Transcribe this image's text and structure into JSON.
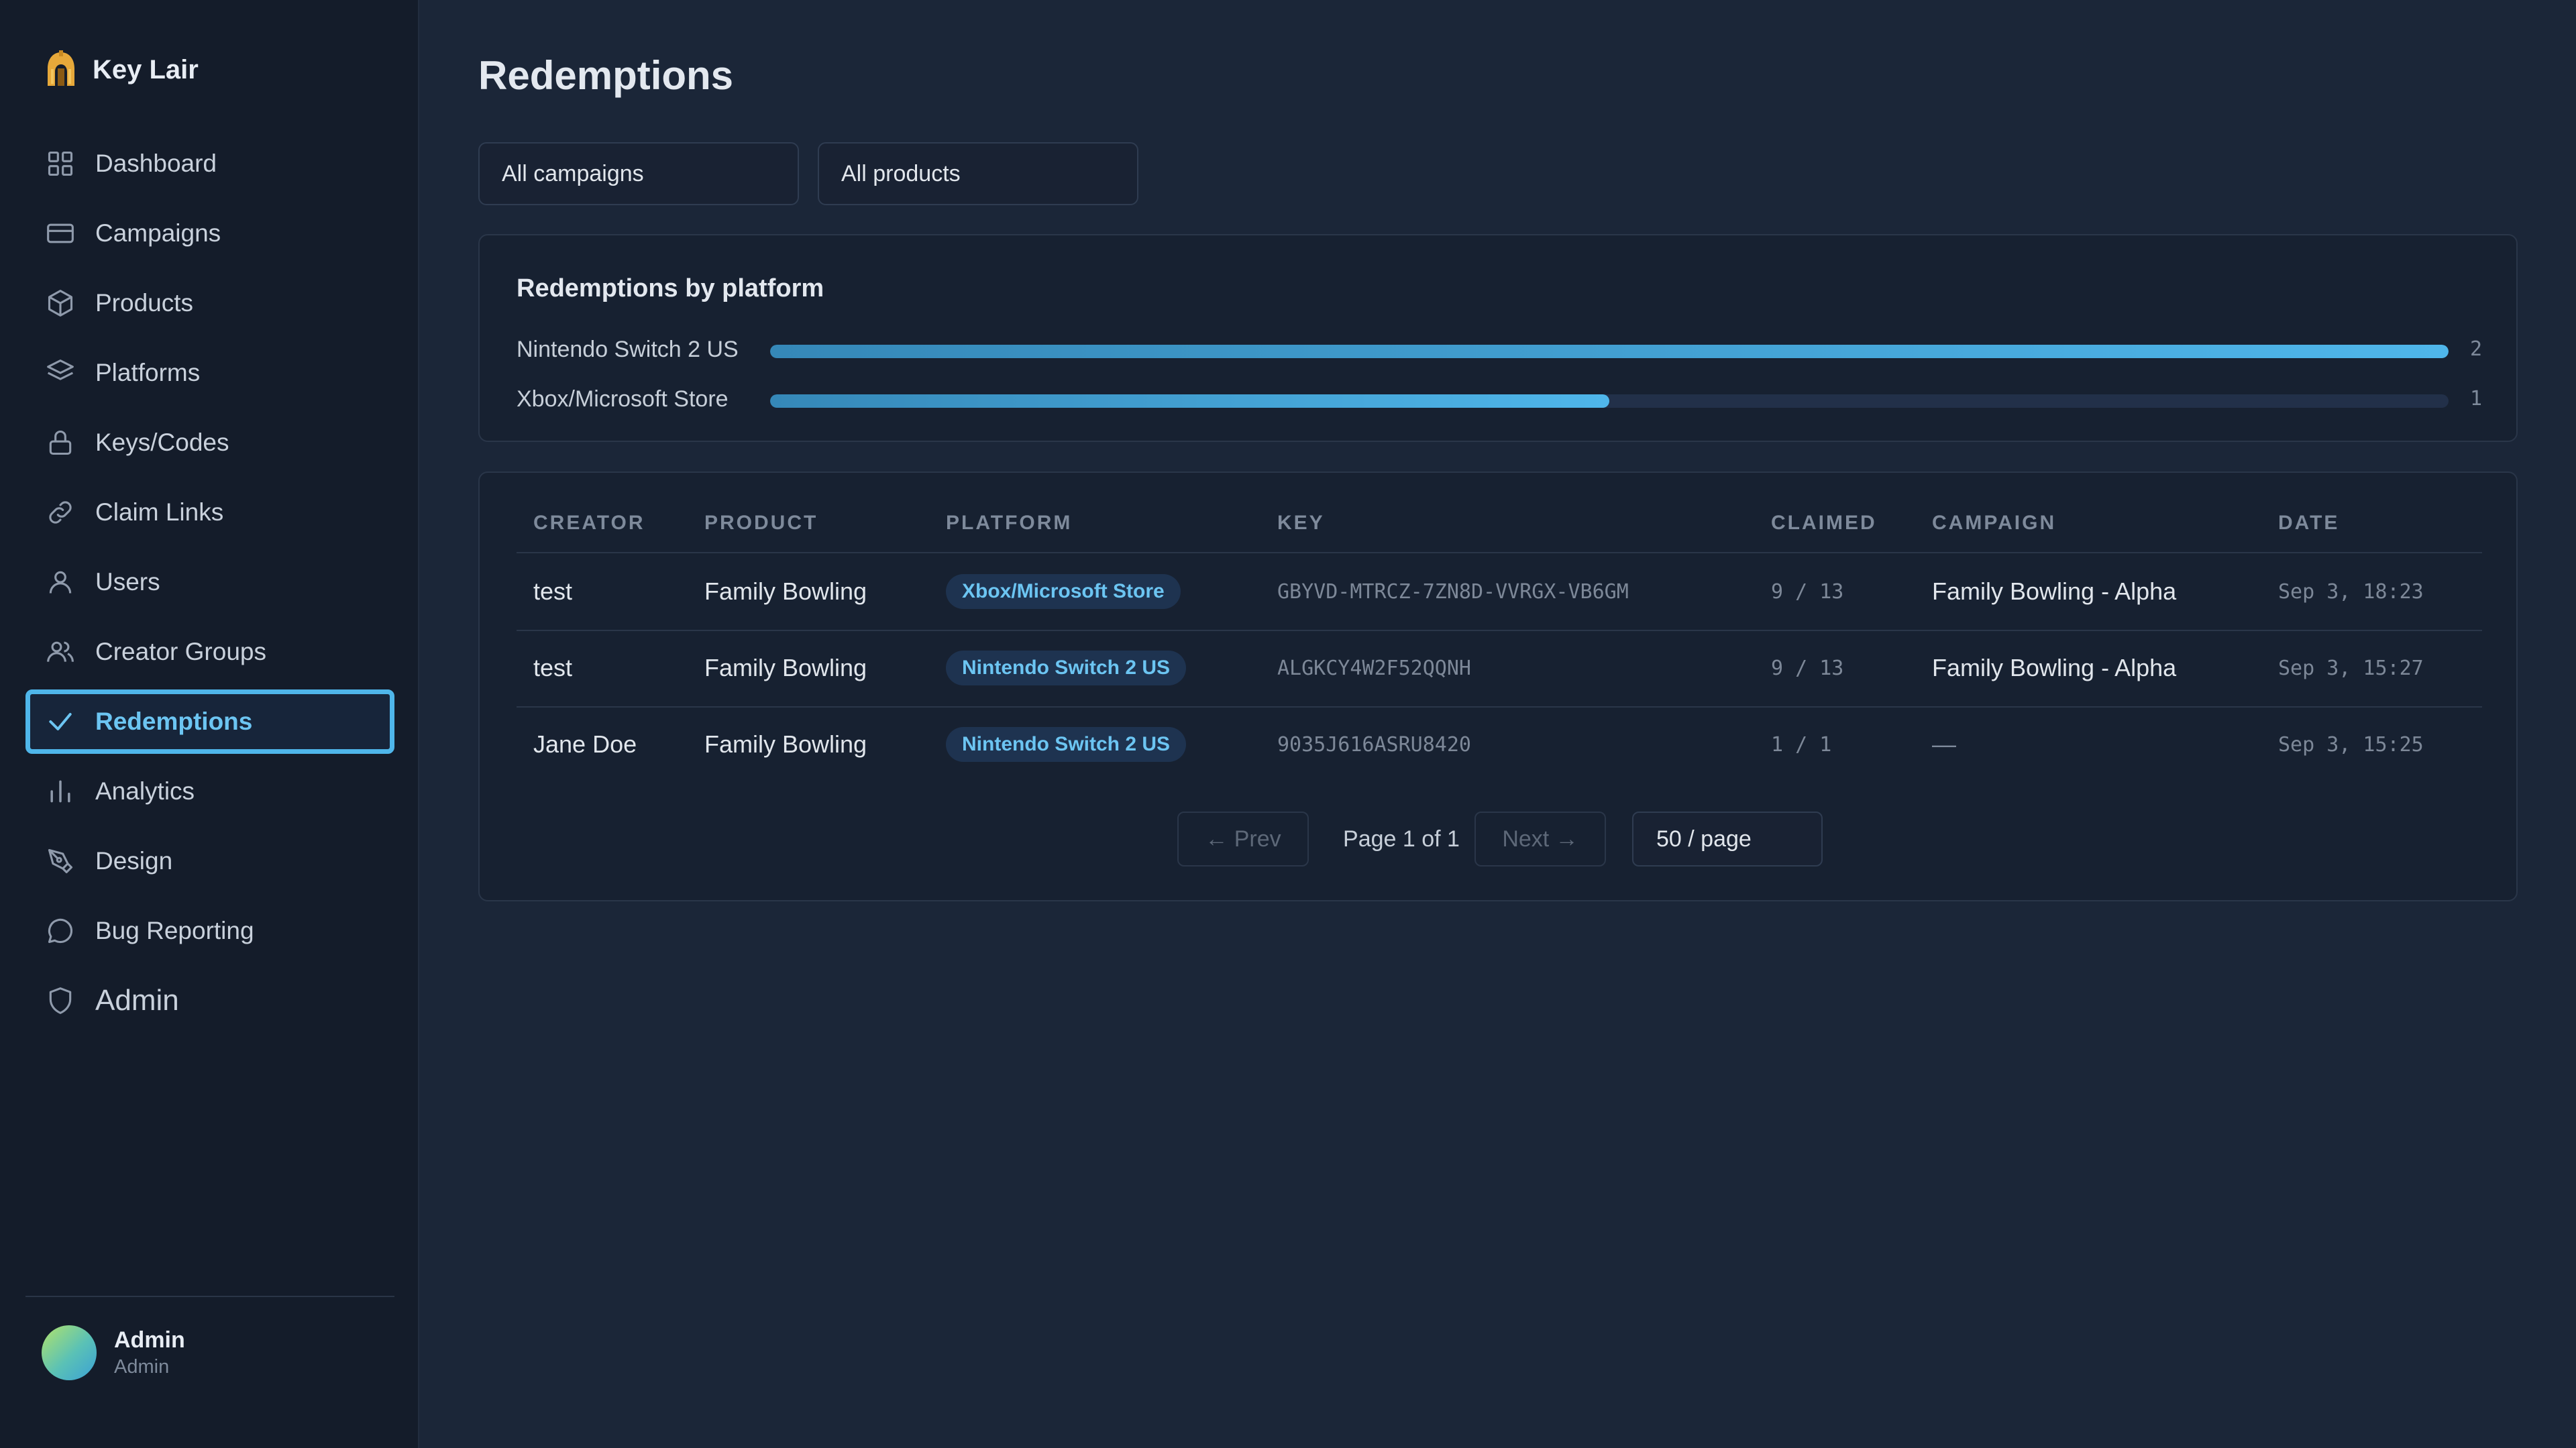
{
  "brand": {
    "name": "Key Lair",
    "icon": "gold-helmet-icon",
    "accent": "#e6a83a"
  },
  "sidebar": {
    "items": [
      {
        "label": "Dashboard",
        "icon": "grid-icon"
      },
      {
        "label": "Campaigns",
        "icon": "card-icon"
      },
      {
        "label": "Products",
        "icon": "cube-icon"
      },
      {
        "label": "Platforms",
        "icon": "layers-icon"
      },
      {
        "label": "Keys/Codes",
        "icon": "lock-icon"
      },
      {
        "label": "Claim Links",
        "icon": "link-icon"
      },
      {
        "label": "Users",
        "icon": "user-icon"
      },
      {
        "label": "Creator Groups",
        "icon": "users-icon"
      },
      {
        "label": "Redemptions",
        "icon": "check-icon",
        "active": true
      },
      {
        "label": "Analytics",
        "icon": "bar-chart-icon"
      },
      {
        "label": "Design",
        "icon": "pen-tool-icon"
      },
      {
        "label": "Bug Reporting",
        "icon": "message-circle-icon"
      },
      {
        "label": "Admin",
        "icon": "shield-icon"
      }
    ]
  },
  "user": {
    "name": "Admin",
    "role": "Admin"
  },
  "page": {
    "title": "Redemptions"
  },
  "filters": {
    "campaign": "All campaigns",
    "product": "All products"
  },
  "chart_data": {
    "type": "bar",
    "title": "Redemptions by platform",
    "orientation": "horizontal",
    "categories": [
      "Nintendo Switch 2 US",
      "Xbox/Microsoft Store"
    ],
    "values": [
      2,
      1
    ],
    "xlim": [
      0,
      2
    ],
    "bar_color": "#4fb6ea"
  },
  "table": {
    "columns": [
      "CREATOR",
      "PRODUCT",
      "PLATFORM",
      "KEY",
      "CLAIMED",
      "CAMPAIGN",
      "DATE"
    ],
    "rows": [
      {
        "creator": "test",
        "product": "Family Bowling",
        "platform": "Xbox/Microsoft Store",
        "key": "GBYVD-MTRCZ-7ZN8D-VVRGX-VB6GM",
        "claimed": "9 / 13",
        "campaign": "Family Bowling - Alpha",
        "date": "Sep 3, 18:23"
      },
      {
        "creator": "test",
        "product": "Family Bowling",
        "platform": "Nintendo Switch 2 US",
        "key": "ALGKCY4W2F52QQNH",
        "claimed": "9 / 13",
        "campaign": "Family Bowling - Alpha",
        "date": "Sep 3, 15:27"
      },
      {
        "creator": "Jane Doe",
        "product": "Family Bowling",
        "platform": "Nintendo Switch 2 US",
        "key": "9035J616ASRU8420",
        "claimed": "1 / 1",
        "campaign": "—",
        "date": "Sep 3, 15:25"
      }
    ]
  },
  "pagination": {
    "prev": "← Prev",
    "info": "Page 1 of 1",
    "next": "Next →",
    "page_size": "50 / page"
  }
}
